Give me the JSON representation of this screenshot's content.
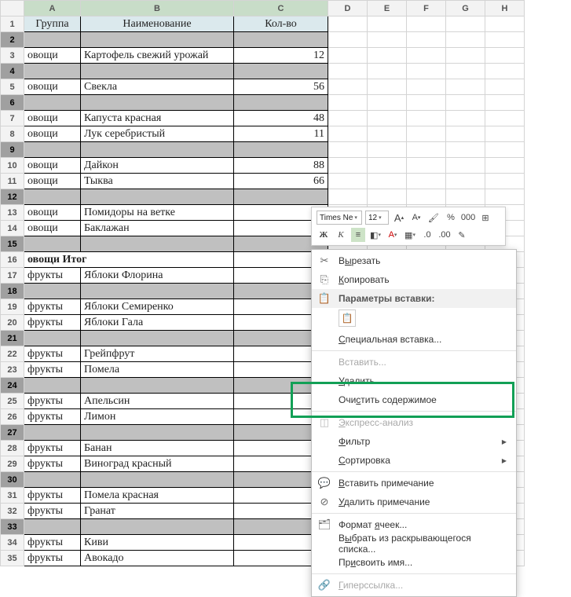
{
  "cols": [
    "A",
    "B",
    "C",
    "D",
    "E",
    "F",
    "G",
    "H"
  ],
  "headers": {
    "A": "Группа",
    "B": "Наименование",
    "C": "Кол-во"
  },
  "rows": [
    {
      "n": 1,
      "type": "hdr"
    },
    {
      "n": 2,
      "type": "blank"
    },
    {
      "n": 3,
      "type": "data",
      "a": "овощи",
      "b": "Картофель свежий урожай",
      "c": "12"
    },
    {
      "n": 4,
      "type": "blank"
    },
    {
      "n": 5,
      "type": "data",
      "a": "овощи",
      "b": "Свекла",
      "c": "56"
    },
    {
      "n": 6,
      "type": "blank"
    },
    {
      "n": 7,
      "type": "data",
      "a": "овощи",
      "b": "Капуста красная",
      "c": "48"
    },
    {
      "n": 8,
      "type": "data",
      "a": "овощи",
      "b": "Лук серебристый",
      "c": "11"
    },
    {
      "n": 9,
      "type": "blank"
    },
    {
      "n": 10,
      "type": "data",
      "a": "овощи",
      "b": "Дайкон",
      "c": "88"
    },
    {
      "n": 11,
      "type": "data",
      "a": "овощи",
      "b": "Тыква",
      "c": "66"
    },
    {
      "n": 12,
      "type": "blank"
    },
    {
      "n": 13,
      "type": "data",
      "a": "овощи",
      "b": "Помидоры на ветке",
      "c": ""
    },
    {
      "n": 14,
      "type": "data",
      "a": "овощи",
      "b": "Баклажан",
      "c": ""
    },
    {
      "n": 15,
      "type": "blank"
    },
    {
      "n": 16,
      "type": "subtotal",
      "a": "овощи Итог",
      "b": ""
    },
    {
      "n": 17,
      "type": "data",
      "a": "фрукты",
      "b": "Яблоки Флорина",
      "c": ""
    },
    {
      "n": 18,
      "type": "blank"
    },
    {
      "n": 19,
      "type": "data",
      "a": "фрукты",
      "b": "Яблоки Семиренко",
      "c": ""
    },
    {
      "n": 20,
      "type": "data",
      "a": "фрукты",
      "b": "Яблоки Гала",
      "c": ""
    },
    {
      "n": 21,
      "type": "blank"
    },
    {
      "n": 22,
      "type": "data",
      "a": "фрукты",
      "b": "Грейпфрут",
      "c": ""
    },
    {
      "n": 23,
      "type": "data",
      "a": "фрукты",
      "b": "Помела",
      "c": ""
    },
    {
      "n": 24,
      "type": "blank"
    },
    {
      "n": 25,
      "type": "data",
      "a": "фрукты",
      "b": "Апельсин",
      "c": ""
    },
    {
      "n": 26,
      "type": "data",
      "a": "фрукты",
      "b": "Лимон",
      "c": ""
    },
    {
      "n": 27,
      "type": "blank"
    },
    {
      "n": 28,
      "type": "data",
      "a": "фрукты",
      "b": "Банан",
      "c": ""
    },
    {
      "n": 29,
      "type": "data",
      "a": "фрукты",
      "b": "Виноград  красный",
      "c": ""
    },
    {
      "n": 30,
      "type": "blank"
    },
    {
      "n": 31,
      "type": "data",
      "a": "фрукты",
      "b": "Помела красная",
      "c": ""
    },
    {
      "n": 32,
      "type": "data",
      "a": "фрукты",
      "b": "Гранат",
      "c": ""
    },
    {
      "n": 33,
      "type": "blank"
    },
    {
      "n": 34,
      "type": "data",
      "a": "фрукты",
      "b": "Киви",
      "c": ""
    },
    {
      "n": 35,
      "type": "data",
      "a": "фрукты",
      "b": "Авокадо",
      "c": ""
    }
  ],
  "mini": {
    "font": "Times Ne",
    "size": "12",
    "inc": "A",
    "dec": "A",
    "percent": "%",
    "thousands": "000",
    "bold": "Ж",
    "italic": "К"
  },
  "ctx": {
    "cut": "Вырезать",
    "copy": "Копировать",
    "paste_hdr": "Параметры вставки:",
    "paste_special": "Специальная вставка...",
    "insert": "Вставить...",
    "delete": "Удалить...",
    "clear": "Очистить содержимое",
    "quick": "Экспресс-анализ",
    "filter": "Фильтр",
    "sort": "Сортировка",
    "add_comment": "Вставить примечание",
    "del_comment": "Удалить примечание",
    "format": "Формат ячеек...",
    "dropdown": "Выбрать из раскрывающегося списка...",
    "name": "Присвоить имя...",
    "link": "Гиперссылка..."
  },
  "underline": {
    "cut": "ы",
    "copy": "К",
    "paste_special": "С",
    "delete": "У",
    "clear": "с",
    "quick": "Э",
    "filter": "Ф",
    "sort": "С",
    "add_comment": "В",
    "del_comment": "У",
    "format": "я",
    "dropdown": "ы",
    "name": "и",
    "link": "Г"
  }
}
